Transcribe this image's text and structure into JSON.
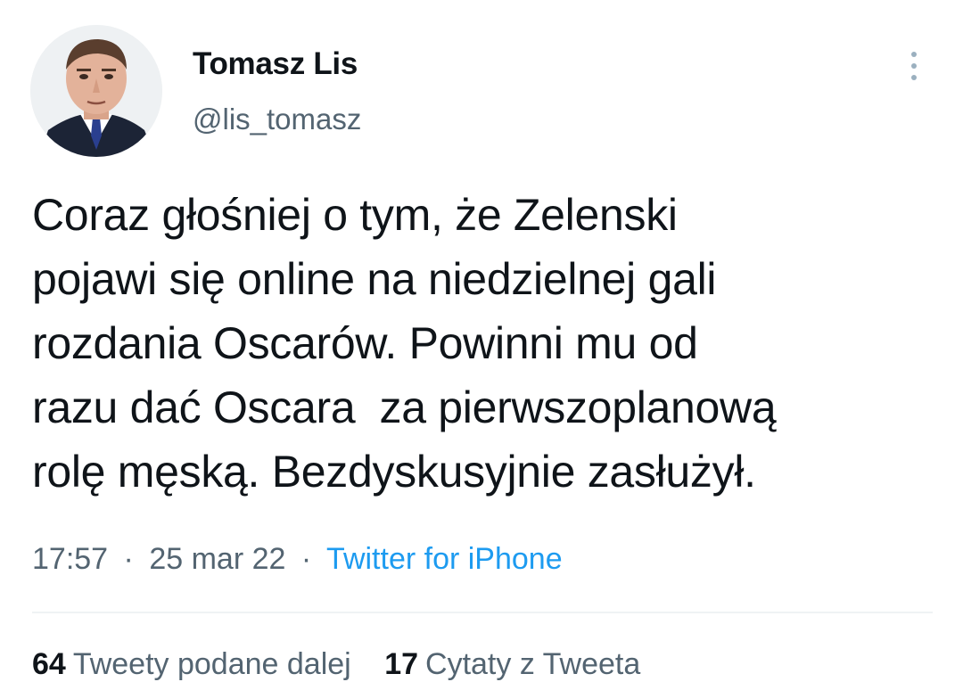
{
  "author": {
    "name": "Tomasz Lis",
    "handle": "@lis_tomasz"
  },
  "tweet": {
    "lines": [
      "Coraz głośniej o tym, że Zelenski",
      "pojawi się online na niedzielnej gali",
      "rozdania Oscarów. Powinni mu od",
      "razu dać Oscara  za pierwszoplanową",
      "rolę męską. Bezdyskusyjnie zasłużył."
    ],
    "time": "17:57",
    "date": "25 mar 22",
    "separator": "·",
    "source": "Twitter for iPhone"
  },
  "stats": {
    "retweets_count": "64",
    "retweets_label": "Tweety podane dalej",
    "quotes_count": "17",
    "quotes_label": "Cytaty z Tweeta"
  },
  "icons": {
    "more": "more-vertical-icon"
  },
  "colors": {
    "text": "#0f1419",
    "secondary": "#536471",
    "link": "#1d9bf0",
    "divider": "#eff3f4"
  }
}
